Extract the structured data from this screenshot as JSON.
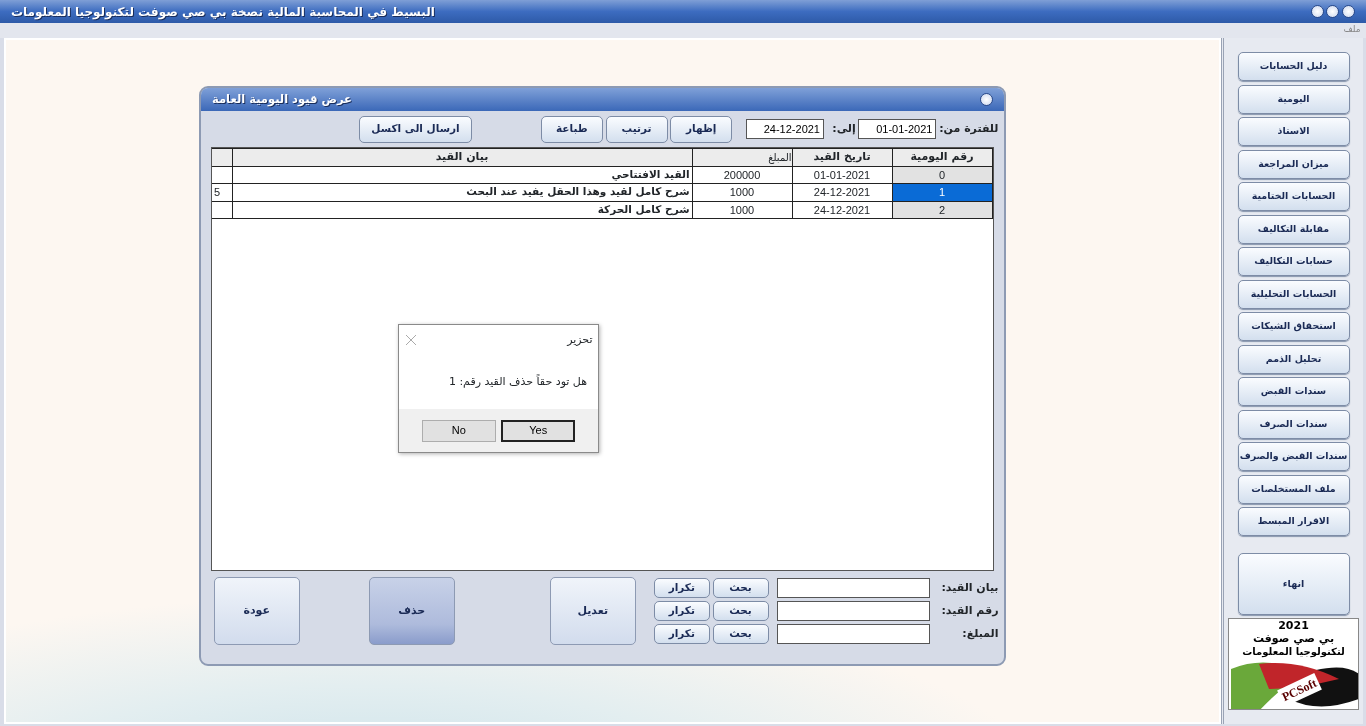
{
  "app": {
    "title": "البسيط في المحاسبة المالية   نصخة بي صي صوفت لتكنولوجيا المعلومات",
    "menu": [
      "ملف"
    ]
  },
  "dialog": {
    "title": "عرض قيود اليومية العامة",
    "period_label": "للفترة من:",
    "from_date": "01-01-2021",
    "to_label": "إلى:",
    "to_date": "24-12-2021",
    "buttons": [
      "إظهار",
      "ترتيب",
      "طباعة"
    ],
    "export_button": "ارسال الى اكسل",
    "table": {
      "columns": [
        "رقم اليومية",
        "تاريخ القيد",
        "المبلغ",
        "بيان القيد"
      ],
      "rows": [
        {
          "number": "0",
          "date": "01-01-2021",
          "amount": "200000",
          "description": "القيد الافتتاحي",
          "selected": false
        },
        {
          "number": "1",
          "date": "24-12-2021",
          "amount": "1000",
          "description": "شرح كامل لقيد وهذا الحقل يفيد عند البحث",
          "column_5": "5",
          "selected": true
        },
        {
          "number": "2",
          "date": "24-12-2021",
          "amount": "1000",
          "description": "شرح كامل الحركة",
          "selected": false
        }
      ]
    },
    "search": [
      {
        "label": "بيان القيد:",
        "search_button": "بحث",
        "repeat_button": "تكرار"
      },
      {
        "label": "رقم القيد:",
        "search_button": "بحث",
        "repeat_button": "تكرار"
      },
      {
        "label": "المبلغ:",
        "search_button": "بحث",
        "repeat_button": "تكرار"
      }
    ],
    "actions": [
      {
        "label": "تعديل",
        "pressed": false
      },
      {
        "label": "حذف",
        "pressed": true
      },
      {
        "label": "عودة",
        "pressed": false
      }
    ]
  },
  "message_box": {
    "title": "تحزير",
    "message": "هل تود حقاً حذف القيد رقم: 1",
    "buttons": [
      {
        "label": "Yes",
        "focused": true
      },
      {
        "label": "No",
        "focused": false
      }
    ]
  },
  "sidebar": {
    "items": [
      {
        "label": "دليل الحسابات"
      },
      {
        "label": "اليومية"
      },
      {
        "label": "الاستاذ"
      },
      {
        "label": "ميزان المراجعة"
      },
      {
        "label": "الحسابات الختامية"
      },
      {
        "label": "مقابلة التكاليف"
      },
      {
        "label": "حسابات التكاليف"
      },
      {
        "label": "الحسابات التحليلية"
      },
      {
        "label": "استحقاق الشيكات"
      },
      {
        "label": "تحليل الذمم"
      },
      {
        "label": "سندات القبض"
      },
      {
        "label": "سندات الصرف"
      },
      {
        "label": "سندات القبض والصرف"
      },
      {
        "label": "ملف المستخلصات"
      },
      {
        "label": "الاقرار المبسط"
      }
    ],
    "exit_button": "انهاء",
    "logo": {
      "year": "2021",
      "line_1": "بي صي صوفت",
      "line_2": "لتكنولوجيا المعلومات",
      "mark": "PCSoft"
    }
  }
}
